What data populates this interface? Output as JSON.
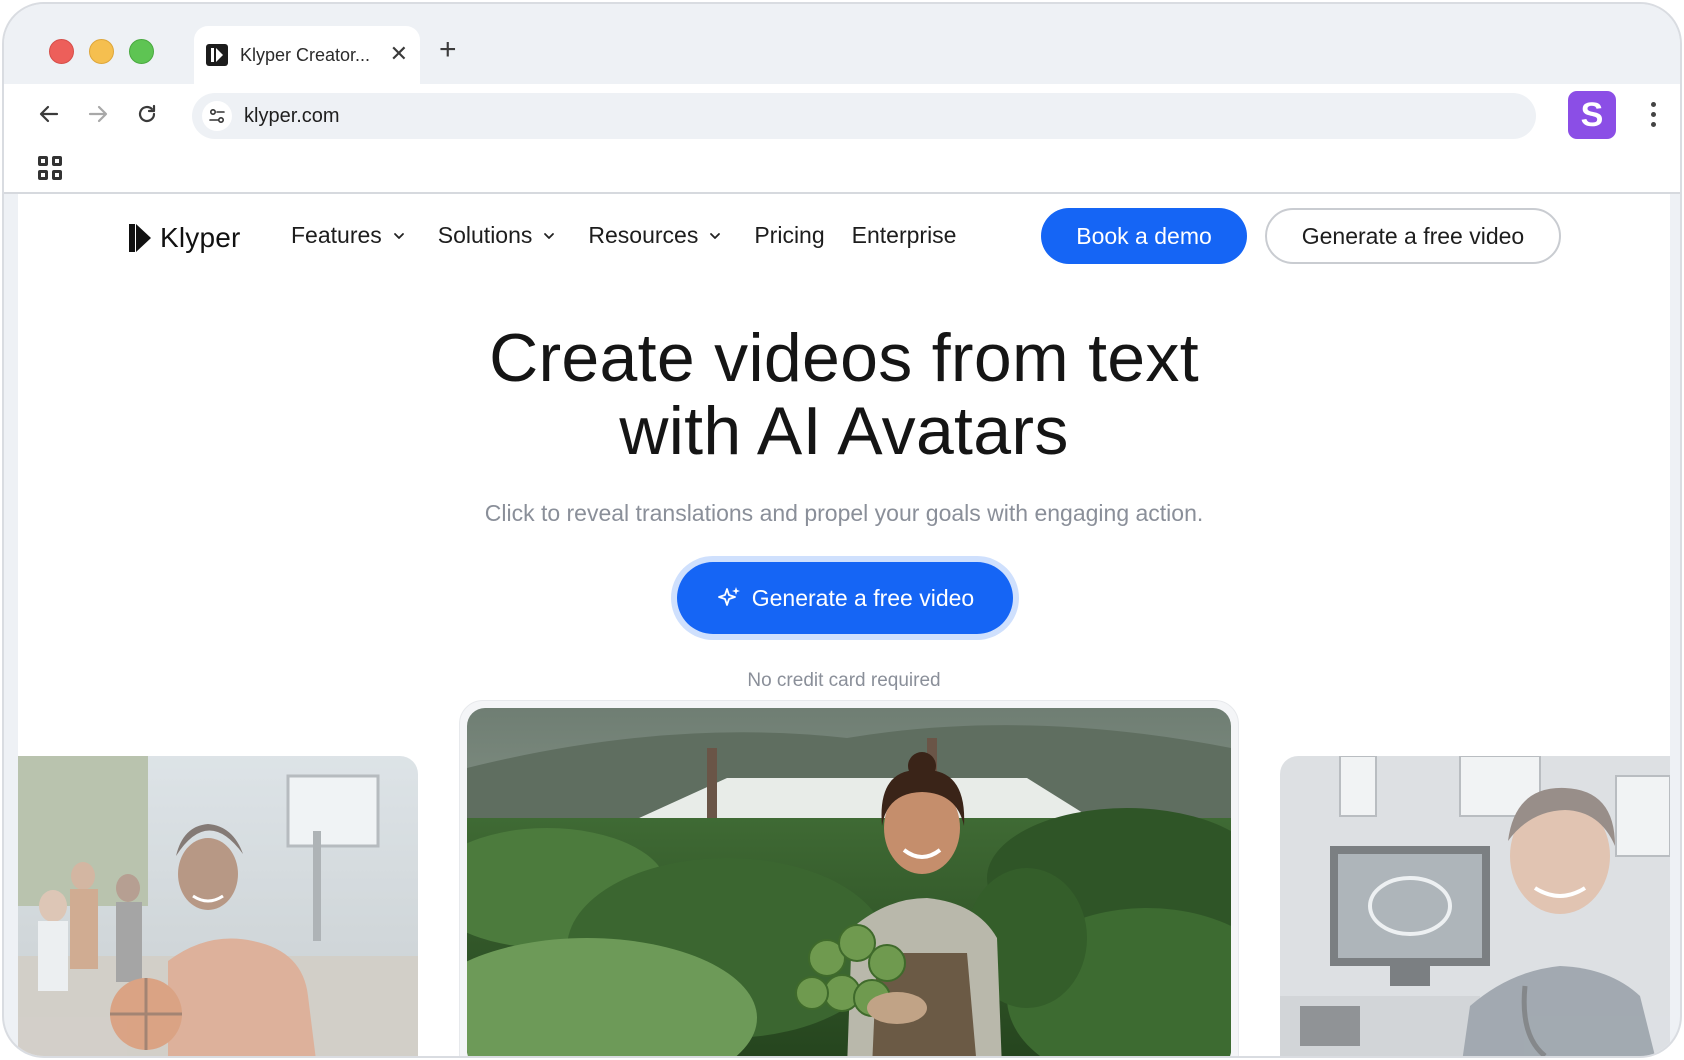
{
  "browser": {
    "tab_title": "Klyper Creator...",
    "tab_close": "✕",
    "new_tab": "+",
    "url": "klyper.com",
    "profile_initial": "S"
  },
  "nav": {
    "logo": "Klyper",
    "links": [
      {
        "label": "Features",
        "dropdown": true
      },
      {
        "label": "Solutions",
        "dropdown": true
      },
      {
        "label": "Resources",
        "dropdown": true
      },
      {
        "label": "Pricing",
        "dropdown": false
      },
      {
        "label": "Enterprise",
        "dropdown": false
      }
    ],
    "book_demo": "Book a demo",
    "generate_free": "Generate a free video"
  },
  "hero": {
    "title_line1": "Create videos from text",
    "title_line2": "with AI Avatars",
    "subtitle": "Click to reveal translations and propel your goals with engaging action.",
    "cta": "Generate a free video",
    "note": "No credit card required"
  },
  "cards": [
    {
      "subject": "basketball player avatar"
    },
    {
      "subject": "farmer holding artichokes avatar"
    },
    {
      "subject": "medical doctor avatar"
    }
  ],
  "colors": {
    "accent": "#1565f5",
    "profile": "#8b4ee6",
    "muted_text": "#8a8f99"
  }
}
